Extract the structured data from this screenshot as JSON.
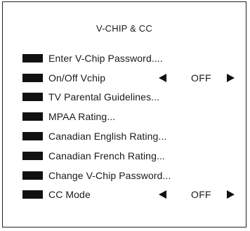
{
  "menu": {
    "title": "V-CHIP & CC",
    "items": [
      {
        "label": "Enter V-Chip Password...."
      },
      {
        "label": "On/Off Vchip",
        "value": "OFF"
      },
      {
        "label": "TV Parental Guidelines..."
      },
      {
        "label": "MPAA Rating..."
      },
      {
        "label": "Canadian English Rating..."
      },
      {
        "label": "Canadian French Rating..."
      },
      {
        "label": "Change V-Chip Password..."
      },
      {
        "label": "CC Mode",
        "value": "OFF"
      }
    ]
  },
  "icons": {
    "item_marker": "item-marker-icon",
    "left_arrow": "left-arrow-icon",
    "right_arrow": "right-arrow-icon"
  },
  "colors": {
    "background": "#ffffff",
    "foreground": "#111111"
  }
}
